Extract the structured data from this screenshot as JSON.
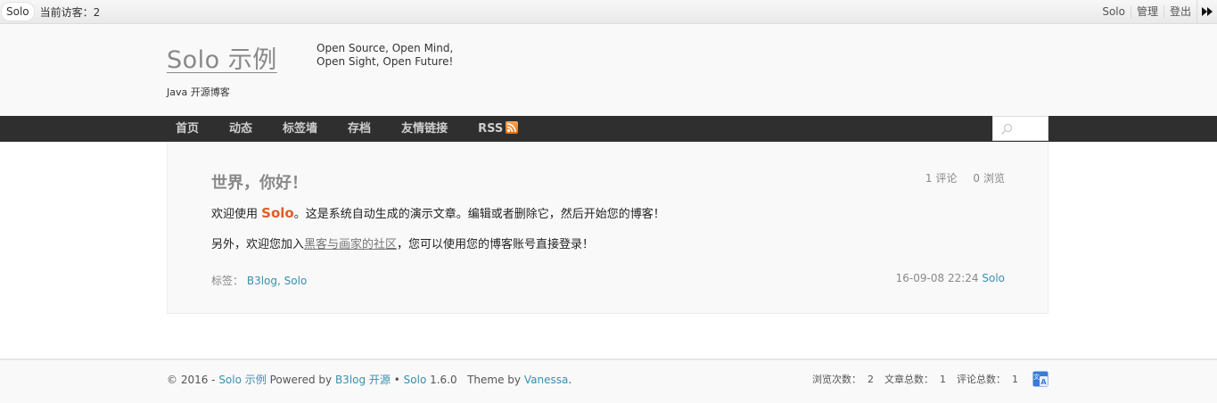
{
  "topbar": {
    "brand_pill": "Solo",
    "visitors": "当前访客：2",
    "links": [
      "Solo",
      "管理",
      "登出"
    ],
    "forward_icon": "fast-forward-icon"
  },
  "header": {
    "title": "Solo 示例",
    "tagline_line1": "Open Source, Open Mind,",
    "tagline_line2": "Open Sight, Open Future!",
    "subtitle": "Java 开源博客"
  },
  "nav": {
    "items": [
      "首页",
      "动态",
      "标签墙",
      "存档",
      "友情链接",
      "RSS"
    ],
    "rss_icon": "rss-icon",
    "search_icon": "search-icon"
  },
  "article": {
    "title": "世界，你好！",
    "comments_count": "1",
    "comments_label": "评论",
    "views_count": "0",
    "views_label": "浏览",
    "p1_before": "欢迎使用 ",
    "p1_brand": "Solo",
    "p1_after": "。这是系统自动生成的演示文章。编辑或者删除它，然后开始您的博客！",
    "p2_before": "另外，欢迎您加入",
    "p2_link": "黑客与画家的社区",
    "p2_after": "，您可以使用您的博客账号直接登录！",
    "tags_label": "标签：",
    "tags": [
      "B3log",
      "Solo"
    ],
    "tag_sep": ", ",
    "date": "16-09-08 22:24",
    "author": "Solo"
  },
  "footer": {
    "copyright": "© 2016 - ",
    "site_link": "Solo 示例",
    "powered_by": " Powered by ",
    "b3log_link": "B3log 开源",
    "bullet": " • ",
    "solo_link": "Solo",
    "version": " 1.6.0   Theme by ",
    "theme_link": "Vanessa",
    "period": ".",
    "views_stat": "浏览次数：  2",
    "articles_stat": "文章总数：  1",
    "comments_stat": "评论总数：  1",
    "translate_icon": "translate-icon"
  }
}
